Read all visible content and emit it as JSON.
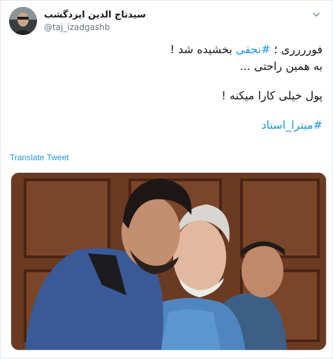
{
  "tweet": {
    "author_name": "سیدتاج الدین ایزدگشب",
    "author_handle": "@taj_izadgashb",
    "line1_before": "فورررری ؛ ",
    "line1_hashtag": "#نجفی",
    "line1_after": " بخشیده شد !",
    "line2": "به همین راحتی ...",
    "line3": "پول خیلی کارا میکنه !",
    "hashtag_line": "#میترا_استاد",
    "translate_label": "Translate Tweet"
  },
  "icons": {
    "caret": "chevron-down-icon",
    "avatar": "profile-avatar"
  },
  "colors": {
    "link": "#1b95e0",
    "text": "#14171a",
    "muted": "#657786"
  }
}
